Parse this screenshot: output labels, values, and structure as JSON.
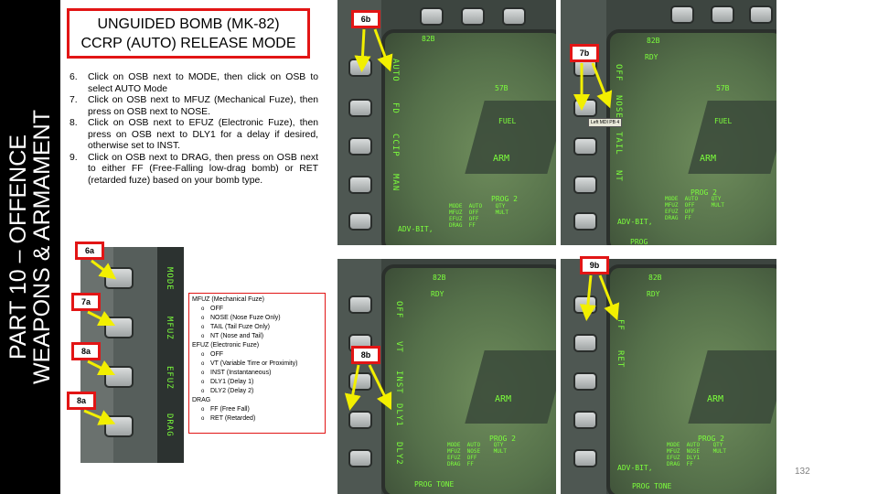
{
  "sidebar": {
    "line1": "PART 10 – OFFENCE",
    "line2": "WEAPONS & ARMAMENT"
  },
  "title": {
    "line1": "UNGUIDED BOMB (MK-82)",
    "line2": "CCRP (AUTO) RELEASE MODE"
  },
  "steps": [
    {
      "num": "6.",
      "text": "Click on OSB next to MODE, then click on OSB to select AUTO Mode"
    },
    {
      "num": "7.",
      "text": "Click on OSB next to MFUZ (Mechanical Fuze), then press on OSB next to NOSE."
    },
    {
      "num": "8.",
      "text": "Click on OSB next to EFUZ (Electronic Fuze), then press on OSB next to DLY1 for a delay if desired, otherwise set to INST."
    },
    {
      "num": "9.",
      "text": "Click on OSB next to DRAG, then press on OSB next to either FF (Free-Falling low-drag bomb) or RET (retarded fuze) based on your bomb type."
    }
  ],
  "fuze_legend": {
    "mfuz_title": "MFUZ (Mechanical Fuze)",
    "mfuz_items": [
      "OFF",
      "NOSE (Nose Fuze Only)",
      "TAIL (Tail Fuze Only)",
      "NT (Nose and Tail)"
    ],
    "efuz_title": "EFUZ (Electronic Fuze)",
    "efuz_items": [
      "OFF",
      "VT (Variable Tirre or Proximity)",
      "INST (Instantaneous)",
      "DLY1 (Delay 1)",
      "DLY2 (Delay 2)"
    ],
    "drag_title": "DRAG",
    "drag_items": [
      "FF (Free Fall)",
      "RET (Retarded)"
    ]
  },
  "callouts": {
    "c6a": "6a",
    "c7a": "7a",
    "c8a1": "8a",
    "c8a2": "8a",
    "c6b": "6b",
    "c7b": "7b",
    "c8b": "8b",
    "c9b": "9b"
  },
  "mfd_left_labels": {
    "mode": "MODE",
    "mfuz": "MFUZ",
    "efuz": "EFUZ",
    "drag": "DRAG"
  },
  "screen_6b": {
    "side": "AUTO",
    "side2": "FD",
    "side3": "CCIP",
    "side4": "MAN",
    "top": "82B",
    "speed": "57B",
    "fuel": "FUEL",
    "arm": "ARM",
    "prog": "PROG 2",
    "adv": "ADV-BIT,",
    "table": "MODE  AUTO    QTY\nMFUZ  OFF     MULT\nEFUZ  OFF\nDRAG  FF"
  },
  "screen_7b": {
    "top": "82B",
    "rdy": "RDY",
    "side": "NOSE",
    "side2": "OFF",
    "side3": "TAIL",
    "side4": "NT",
    "tooltip": "Left MDI PB 4",
    "speed": "57B",
    "fuel": "FUEL",
    "arm": "ARM",
    "prog": "PROG 2",
    "adv": "ADV-BIT,",
    "table": "MODE  AUTO    QTY\nMFUZ  OFF     MULT\nEFUZ  OFF\nDRAG  FF",
    "bottom": "PROG"
  },
  "screen_8b": {
    "top": "82B",
    "rdy": "RDY",
    "side": "OFF",
    "side2": "VT",
    "side3": "INST",
    "side4": "DLY1",
    "side5": "DLY2",
    "arm": "ARM",
    "prog": "PROG 2",
    "table": "MODE  AUTO    QTY\nMFUZ  NOSE    MULT\nEFUZ  OFF\nDRAG  FF",
    "bottom": "PROG   TONE"
  },
  "screen_9b": {
    "top": "82B",
    "rdy": "RDY",
    "side": "FF",
    "side2": "RET",
    "arm": "ARM",
    "prog": "PROG 2",
    "adv": "ADV-BIT,",
    "table": "MODE  AUTO    QTY\nMFUZ  NOSE    MULT\nEFUZ  DLY1\nDRAG  FF",
    "bottom": "PROG   TONE"
  },
  "page_number": "132",
  "colors": {
    "accent_red": "#e21515",
    "hud_green": "#7cff3c",
    "sidebar_bg": "#000000"
  }
}
